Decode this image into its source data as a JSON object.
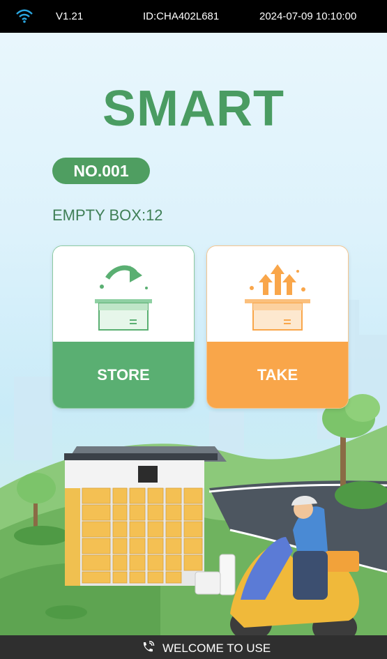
{
  "status_bar": {
    "version": "V1.21",
    "device_id": "ID:CHA402L681",
    "datetime": "2024-07-09 10:10:00"
  },
  "title": "SMART",
  "locker_number": "NO.001",
  "empty_box": "EMPTY BOX:12",
  "actions": {
    "store_label": "STORE",
    "take_label": "TAKE"
  },
  "footer": {
    "text": "WELCOME TO USE"
  },
  "colors": {
    "primary_green": "#4a9c62",
    "store_green": "#5aaf72",
    "take_orange": "#f9a64a"
  }
}
